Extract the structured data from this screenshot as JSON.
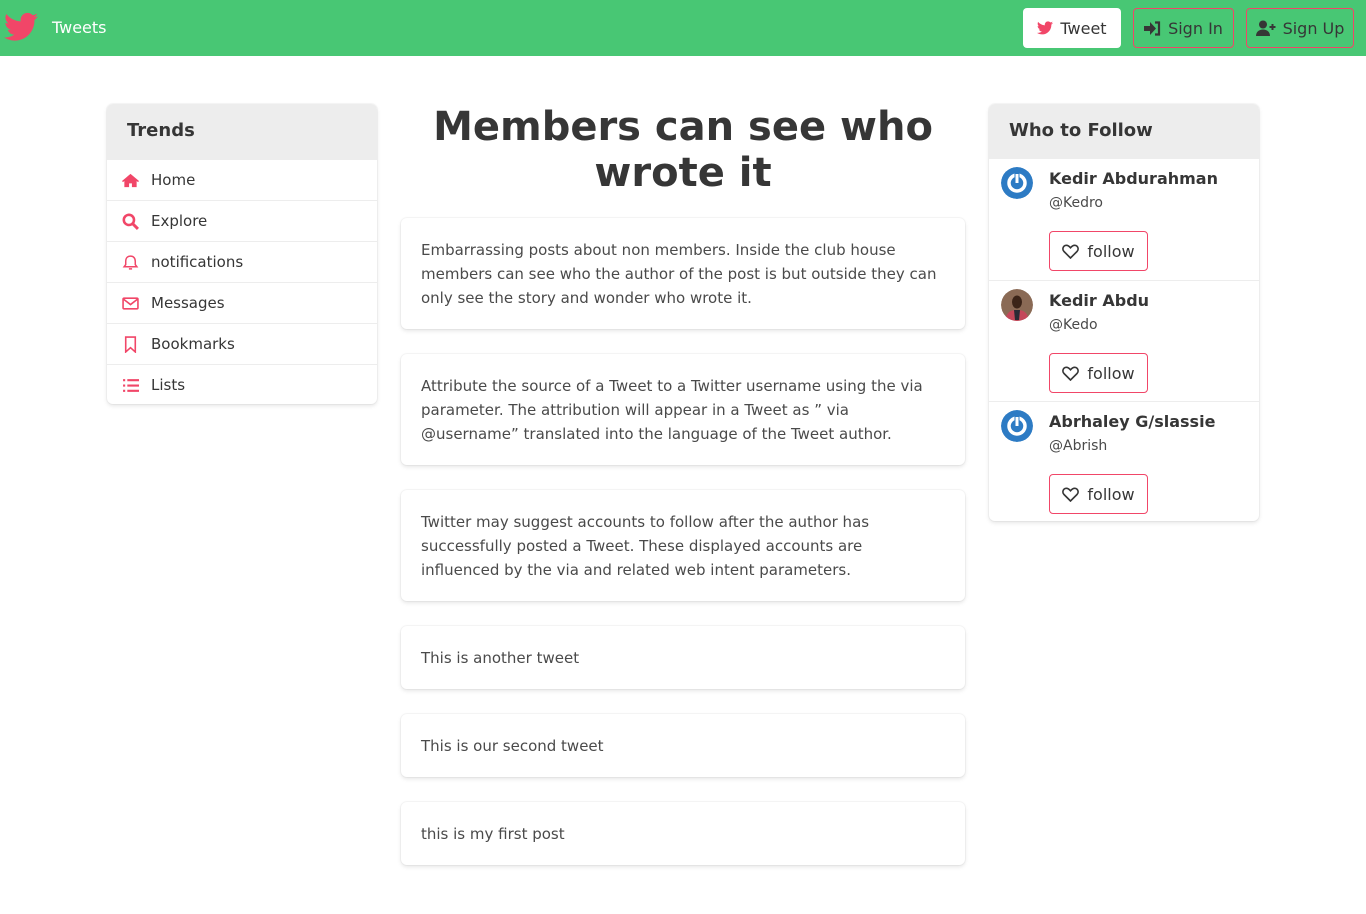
{
  "colors": {
    "navbar": "#48c774",
    "accent": "#f14668"
  },
  "navbar": {
    "brand": "Tweets",
    "tweet_label": "Tweet",
    "signin_label": "Sign In",
    "signup_label": "Sign Up"
  },
  "sidebar": {
    "title": "Trends",
    "items": [
      {
        "label": "Home",
        "icon": "home-icon"
      },
      {
        "label": "Explore",
        "icon": "search-icon"
      },
      {
        "label": "notifications",
        "icon": "bell-icon"
      },
      {
        "label": "Messages",
        "icon": "envelope-icon"
      },
      {
        "label": "Bookmarks",
        "icon": "bookmark-icon"
      },
      {
        "label": "Lists",
        "icon": "list-icon"
      }
    ]
  },
  "main": {
    "title": "Members can see who wrote it",
    "posts": [
      "Embarrassing posts about non members. Inside the club house members can see who the author of the post is but outside they can only see the story and wonder who wrote it.",
      "Attribute the source of a Tweet to a Twitter username using the via parameter. The attribution will appear in a Tweet as ” via @username” translated into the language of the Tweet author.",
      "Twitter may suggest accounts to follow after the author has successfully posted a Tweet. These displayed accounts are influenced by the via and related web intent parameters.",
      "This is another tweet",
      "This is our second tweet",
      "this is my first post"
    ]
  },
  "follow": {
    "title": "Who to Follow",
    "button_label": "follow",
    "users": [
      {
        "name": "Kedir Abdurahman",
        "handle": "@Kedro"
      },
      {
        "name": "Kedir Abdu",
        "handle": "@Kedo"
      },
      {
        "name": "Abrhaley G/slassie",
        "handle": "@Abrish"
      }
    ]
  }
}
